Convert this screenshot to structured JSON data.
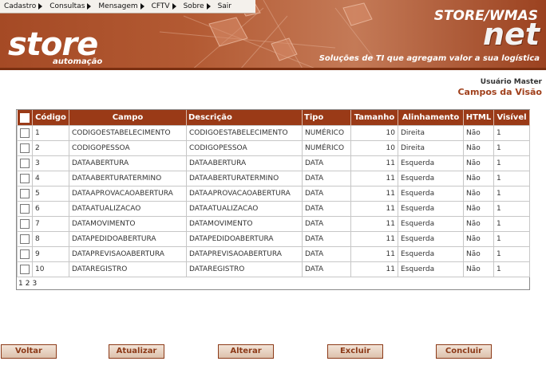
{
  "menu": [
    {
      "label": "Cadastro",
      "has_submenu": true
    },
    {
      "label": "Consultas",
      "has_submenu": true
    },
    {
      "label": "Mensagem",
      "has_submenu": true
    },
    {
      "label": "CFTV",
      "has_submenu": true
    },
    {
      "label": "Sobre",
      "has_submenu": true
    },
    {
      "label": "Sair",
      "has_submenu": false
    }
  ],
  "header": {
    "logo_text": "store",
    "logo_sub": "automação",
    "brand_line1": "STORE/WMAS",
    "brand_line2": "net",
    "slogan": "Soluções de TI que agregam valor a sua logística"
  },
  "user_label": "Usuário Master",
  "page_title": "Campos da Visão",
  "table": {
    "columns": [
      "Código",
      "Campo",
      "Descrição",
      "Tipo",
      "Tamanho",
      "Alinhamento",
      "HTML",
      "Visível"
    ],
    "rows": [
      {
        "codigo": "1",
        "campo": "CODIGOESTABELECIMENTO",
        "descricao": "CODIGOESTABELECIMENTO",
        "tipo": "NUMÉRICO",
        "tamanho": "10",
        "alinhamento": "Direita",
        "html": "Não",
        "visivel": "1"
      },
      {
        "codigo": "2",
        "campo": "CODIGOPESSOA",
        "descricao": "CODIGOPESSOA",
        "tipo": "NUMÉRICO",
        "tamanho": "10",
        "alinhamento": "Direita",
        "html": "Não",
        "visivel": "1"
      },
      {
        "codigo": "3",
        "campo": "DATAABERTURA",
        "descricao": "DATAABERTURA",
        "tipo": "DATA",
        "tamanho": "11",
        "alinhamento": "Esquerda",
        "html": "Não",
        "visivel": "1"
      },
      {
        "codigo": "4",
        "campo": "DATAABERTURATERMINO",
        "descricao": "DATAABERTURATERMINO",
        "tipo": "DATA",
        "tamanho": "11",
        "alinhamento": "Esquerda",
        "html": "Não",
        "visivel": "1"
      },
      {
        "codigo": "5",
        "campo": "DATAAPROVACAOABERTURA",
        "descricao": "DATAAPROVACAOABERTURA",
        "tipo": "DATA",
        "tamanho": "11",
        "alinhamento": "Esquerda",
        "html": "Não",
        "visivel": "1"
      },
      {
        "codigo": "6",
        "campo": "DATAATUALIZACAO",
        "descricao": "DATAATUALIZACAO",
        "tipo": "DATA",
        "tamanho": "11",
        "alinhamento": "Esquerda",
        "html": "Não",
        "visivel": "1"
      },
      {
        "codigo": "7",
        "campo": "DATAMOVIMENTO",
        "descricao": "DATAMOVIMENTO",
        "tipo": "DATA",
        "tamanho": "11",
        "alinhamento": "Esquerda",
        "html": "Não",
        "visivel": "1"
      },
      {
        "codigo": "8",
        "campo": "DATAPEDIDOABERTURA",
        "descricao": "DATAPEDIDOABERTURA",
        "tipo": "DATA",
        "tamanho": "11",
        "alinhamento": "Esquerda",
        "html": "Não",
        "visivel": "1"
      },
      {
        "codigo": "9",
        "campo": "DATAPREVISAOABERTURA",
        "descricao": "DATAPREVISAOABERTURA",
        "tipo": "DATA",
        "tamanho": "11",
        "alinhamento": "Esquerda",
        "html": "Não",
        "visivel": "1"
      },
      {
        "codigo": "10",
        "campo": "DATAREGISTRO",
        "descricao": "DATAREGISTRO",
        "tipo": "DATA",
        "tamanho": "11",
        "alinhamento": "Esquerda",
        "html": "Não",
        "visivel": "1"
      }
    ]
  },
  "pagination": [
    "1",
    "2",
    "3"
  ],
  "buttons": {
    "voltar": "Voltar",
    "atualizar": "Atualizar",
    "alterar": "Alterar",
    "excluir": "Excluir",
    "concluir": "Concluir"
  },
  "colors": {
    "brand": "#9a3a17",
    "banner": "#b35a33",
    "title": "#a0401c"
  }
}
